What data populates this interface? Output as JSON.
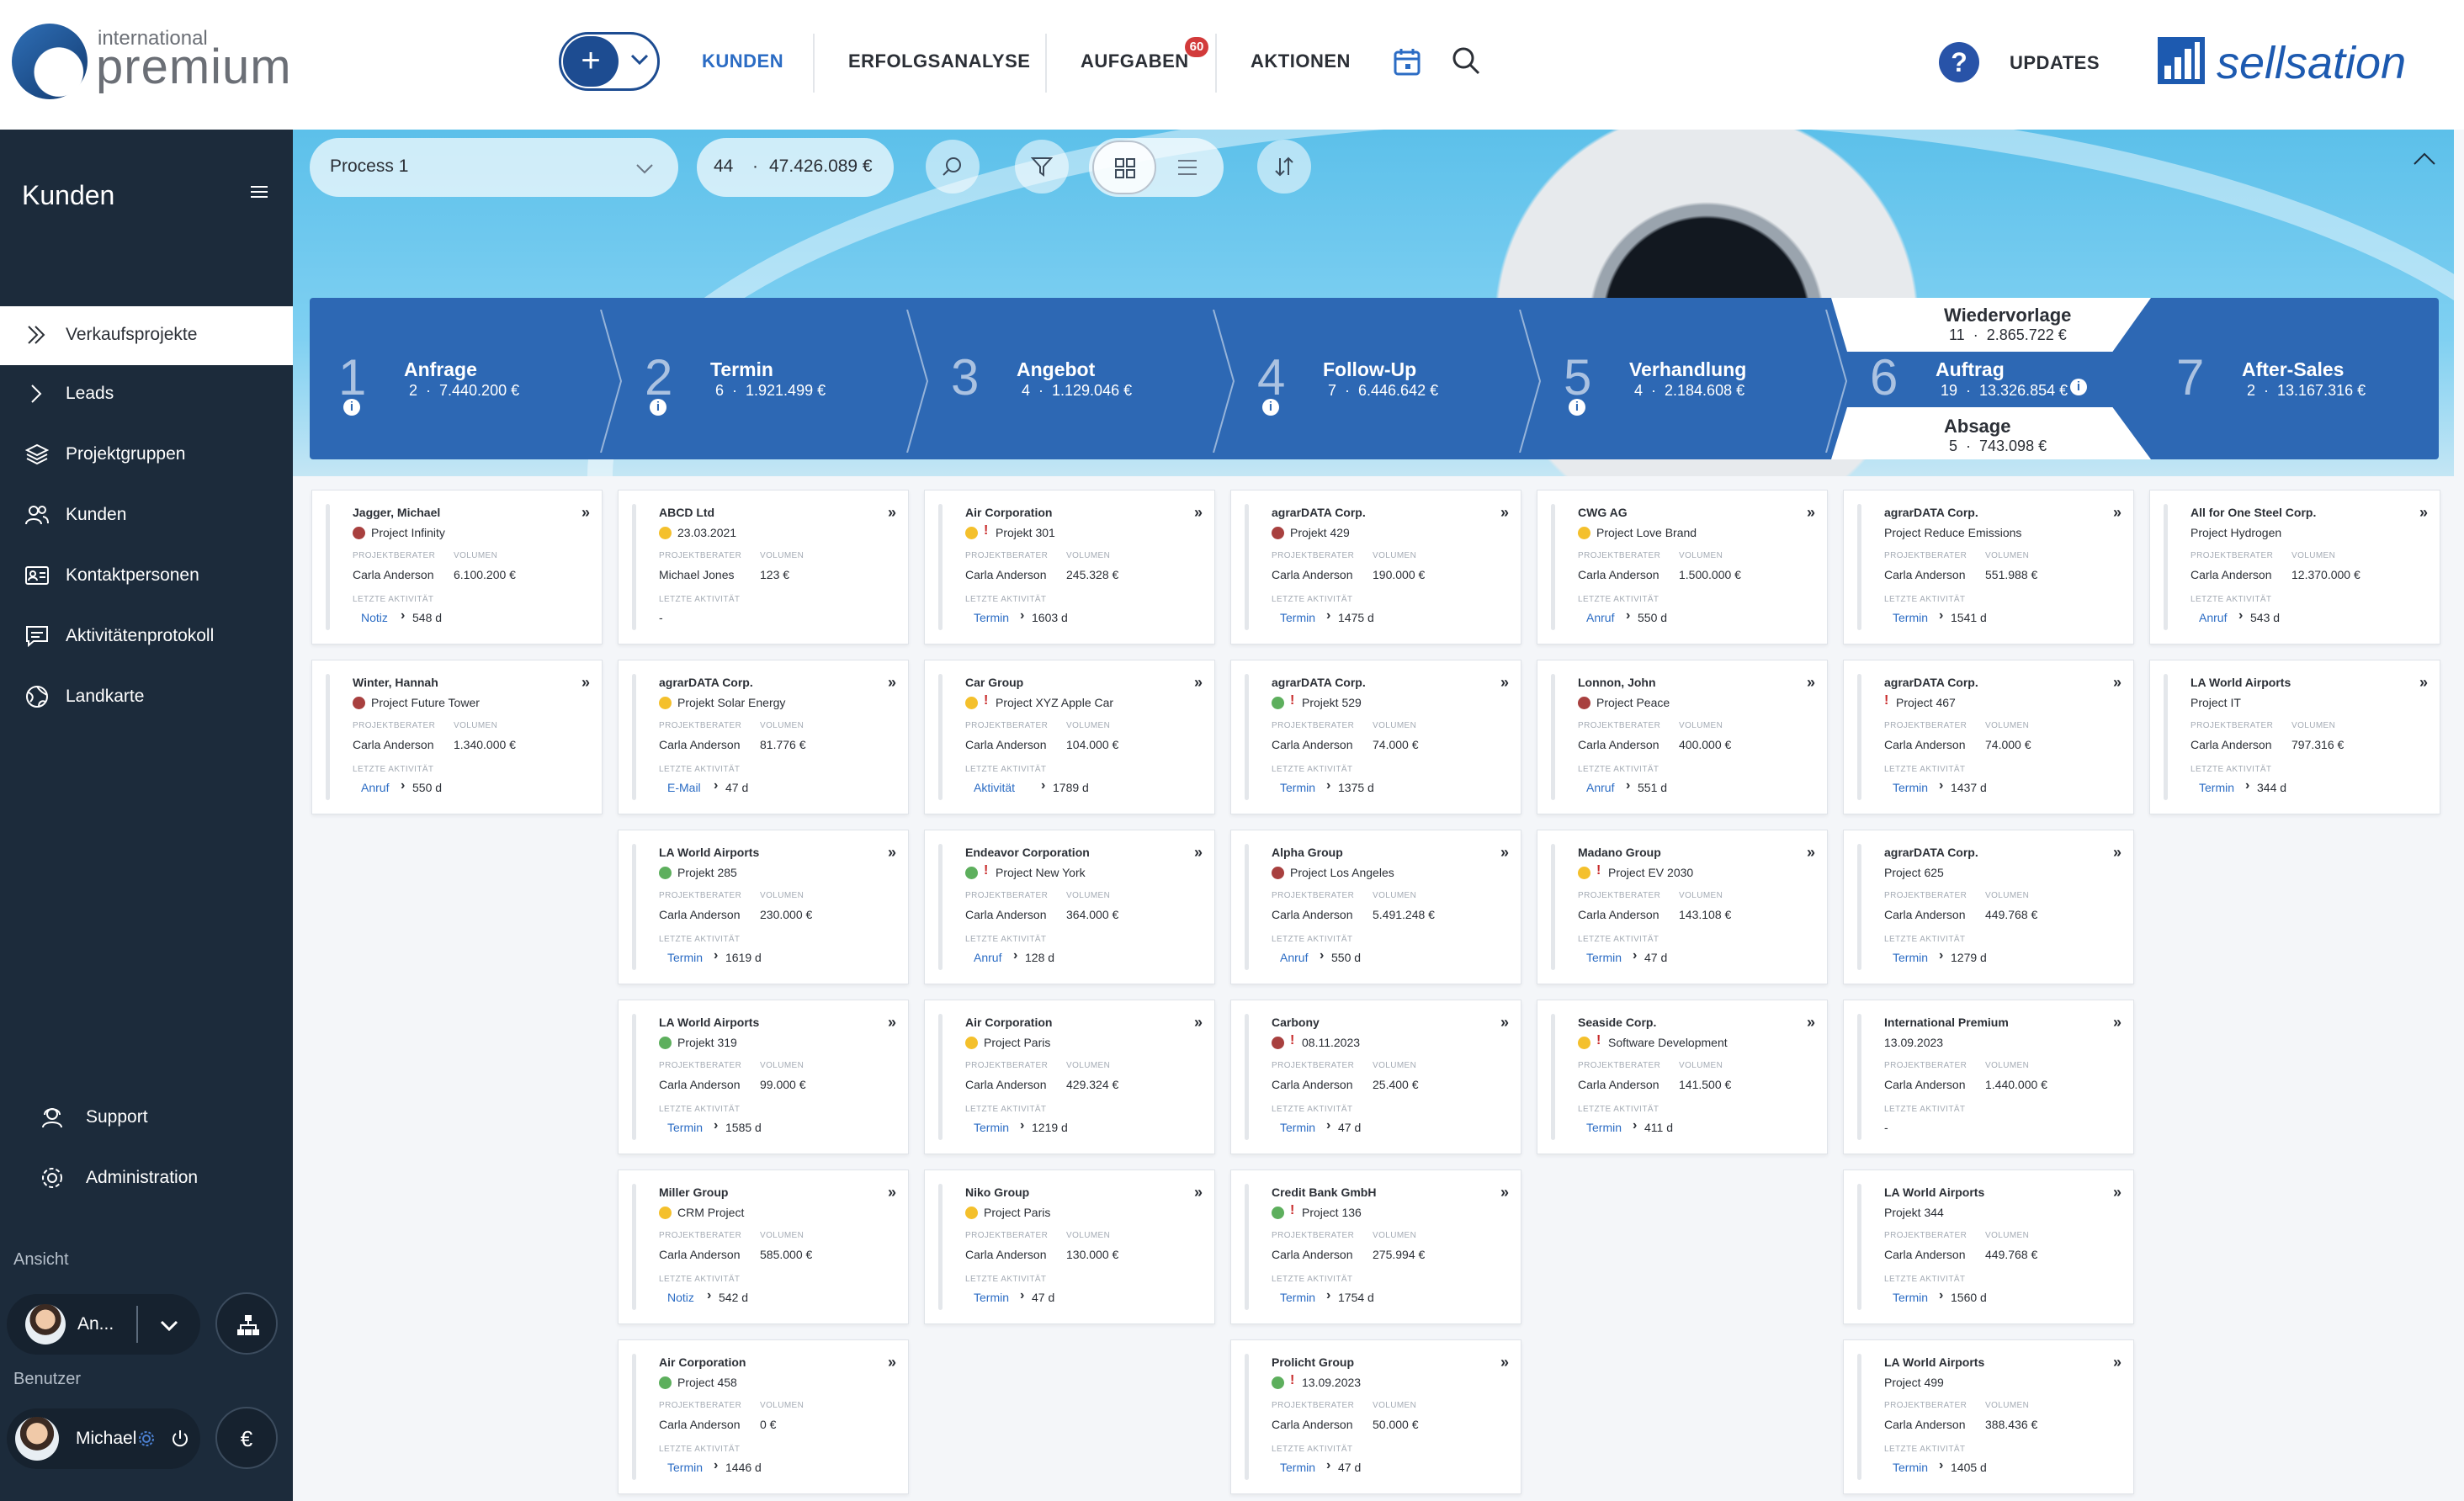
{
  "header": {
    "logo_small": "international",
    "logo_big": "premium",
    "nav": [
      "KUNDEN",
      "ERFOLGSANALYSE",
      "AUFGABEN",
      "AKTIONEN"
    ],
    "tasks_badge": "60",
    "updates_label": "UPDATES",
    "brand": "sellsation",
    "help": "?"
  },
  "sidebar": {
    "title": "Kunden",
    "items": [
      "Verkaufsprojekte",
      "Leads",
      "Projektgruppen",
      "Kunden",
      "Kontaktpersonen",
      "Aktivitätenprotokoll",
      "Landkarte"
    ],
    "bottom": [
      "Support",
      "Administration"
    ],
    "view_label": "Ansicht",
    "view_user": "An...",
    "user_label": "Benutzer",
    "user_name": "Michael",
    "currency": "€"
  },
  "toolbar": {
    "process": "Process 1",
    "count": "44",
    "sum": "47.426.089 €"
  },
  "stages": [
    {
      "num": "1",
      "name": "Anfrage",
      "count": "2",
      "sum": "7.440.200 €",
      "info": true
    },
    {
      "num": "2",
      "name": "Termin",
      "count": "6",
      "sum": "1.921.499 €",
      "info": true
    },
    {
      "num": "3",
      "name": "Angebot",
      "count": "4",
      "sum": "1.129.046 €",
      "info": false
    },
    {
      "num": "4",
      "name": "Follow-Up",
      "count": "7",
      "sum": "6.446.642 €",
      "info": true
    },
    {
      "num": "5",
      "name": "Verhandlung",
      "count": "4",
      "sum": "2.184.608 €",
      "info": true
    },
    {
      "num": "6",
      "name": "Auftrag",
      "count": "19",
      "sum": "13.326.854 €",
      "info": true
    },
    {
      "num": "7",
      "name": "After-Sales",
      "count": "2",
      "sum": "13.167.316 €",
      "info": false
    }
  ],
  "stage_split": {
    "top": {
      "name": "Wiedervorlage",
      "count": "11",
      "sum": "2.865.722 €"
    },
    "bottom": {
      "name": "Absage",
      "count": "5",
      "sum": "743.098 €"
    }
  },
  "card_labels": {
    "advisor": "PROJEKTBERATER",
    "volume": "VOLUMEN",
    "last": "LETZTE AKTIVITÄT"
  },
  "colors": {
    "red": "#a8403f",
    "yellow": "#f4c02c",
    "green": "#5daf5d",
    "accent": "#2b6cc4",
    "sidebar": "#1c2b3b",
    "stagebar": "#2d68b4"
  },
  "columns": [
    [
      {
        "company": "Jagger, Michael",
        "status": "red",
        "flag": false,
        "project": "Project Infinity",
        "advisor": "Carla Anderson",
        "volume": "6.100.200 €",
        "activity": "Notiz",
        "days": "548 d"
      },
      {
        "company": "Winter, Hannah",
        "status": "red",
        "flag": false,
        "project": "Project Future Tower",
        "advisor": "Carla Anderson",
        "volume": "1.340.000 €",
        "activity": "Anruf",
        "days": "550 d"
      }
    ],
    [
      {
        "company": "ABCD Ltd",
        "status": "yellow",
        "flag": false,
        "project": "23.03.2021",
        "advisor": "Michael Jones",
        "volume": "123 €",
        "activity": "",
        "days": ""
      },
      {
        "company": "agrarDATA Corp.",
        "status": "yellow",
        "flag": false,
        "project": "Projekt Solar Energy",
        "advisor": "Carla Anderson",
        "volume": "81.776 €",
        "activity": "E-Mail",
        "days": "47 d"
      },
      {
        "company": "LA World Airports",
        "status": "green",
        "flag": false,
        "project": "Projekt 285",
        "advisor": "Carla Anderson",
        "volume": "230.000 €",
        "activity": "Termin",
        "days": "1619 d"
      },
      {
        "company": "LA World Airports",
        "status": "green",
        "flag": false,
        "project": "Projekt 319",
        "advisor": "Carla Anderson",
        "volume": "99.000 €",
        "activity": "Termin",
        "days": "1585 d"
      },
      {
        "company": "Miller Group",
        "status": "yellow",
        "flag": false,
        "project": "CRM Project",
        "advisor": "Carla Anderson",
        "volume": "585.000 €",
        "activity": "Notiz",
        "days": "542 d"
      },
      {
        "company": "Air Corporation",
        "status": "green",
        "flag": false,
        "project": "Project 458",
        "advisor": "Carla Anderson",
        "volume": "0 €",
        "activity": "Termin",
        "days": "1446 d"
      }
    ],
    [
      {
        "company": "Air Corporation",
        "status": "yellow",
        "flag": true,
        "project": "Projekt 301",
        "advisor": "Carla Anderson",
        "volume": "245.328 €",
        "activity": "Termin",
        "days": "1603 d"
      },
      {
        "company": "Car Group",
        "status": "yellow",
        "flag": true,
        "project": "Project XYZ Apple Car",
        "advisor": "Carla Anderson",
        "volume": "104.000 €",
        "activity": "Aktivität",
        "days": "1789 d"
      },
      {
        "company": "Endeavor Corporation",
        "status": "green",
        "flag": true,
        "project": "Project New York",
        "advisor": "Carla Anderson",
        "volume": "364.000 €",
        "activity": "Anruf",
        "days": "128 d"
      },
      {
        "company": "Air Corporation",
        "status": "yellow",
        "flag": false,
        "project": "Project Paris",
        "advisor": "Carla Anderson",
        "volume": "429.324 €",
        "activity": "Termin",
        "days": "1219 d"
      },
      {
        "company": "Niko Group",
        "status": "yellow",
        "flag": false,
        "project": "Project Paris",
        "advisor": "Carla Anderson",
        "volume": "130.000 €",
        "activity": "Termin",
        "days": "47 d"
      }
    ],
    [
      {
        "company": "agrarDATA Corp.",
        "status": "red",
        "flag": false,
        "project": "Projekt 429",
        "advisor": "Carla Anderson",
        "volume": "190.000 €",
        "activity": "Termin",
        "days": "1475 d"
      },
      {
        "company": "agrarDATA Corp.",
        "status": "green",
        "flag": true,
        "project": "Projekt 529",
        "advisor": "Carla Anderson",
        "volume": "74.000 €",
        "activity": "Termin",
        "days": "1375 d"
      },
      {
        "company": "Alpha Group",
        "status": "red",
        "flag": false,
        "project": "Project Los Angeles",
        "advisor": "Carla Anderson",
        "volume": "5.491.248 €",
        "activity": "Anruf",
        "days": "550 d"
      },
      {
        "company": "Carbony",
        "status": "red",
        "flag": true,
        "project": "08.11.2023",
        "advisor": "Carla Anderson",
        "volume": "25.400 €",
        "activity": "Termin",
        "days": "47 d"
      },
      {
        "company": "Credit Bank GmbH",
        "status": "green",
        "flag": true,
        "project": "Project 136",
        "advisor": "Carla Anderson",
        "volume": "275.994 €",
        "activity": "Termin",
        "days": "1754 d"
      },
      {
        "company": "Prolicht Group",
        "status": "green",
        "flag": true,
        "project": "13.09.2023",
        "advisor": "Carla Anderson",
        "volume": "50.000 €",
        "activity": "Termin",
        "days": "47 d"
      }
    ],
    [
      {
        "company": "CWG AG",
        "status": "yellow",
        "flag": false,
        "project": "Project Love Brand",
        "advisor": "Carla Anderson",
        "volume": "1.500.000 €",
        "activity": "Anruf",
        "days": "550 d"
      },
      {
        "company": "Lonnon, John",
        "status": "red",
        "flag": false,
        "project": "Project Peace",
        "advisor": "Carla Anderson",
        "volume": "400.000 €",
        "activity": "Anruf",
        "days": "551 d"
      },
      {
        "company": "Madano Group",
        "status": "yellow",
        "flag": true,
        "project": "Project EV 2030",
        "advisor": "Carla Anderson",
        "volume": "143.108 €",
        "activity": "Termin",
        "days": "47 d"
      },
      {
        "company": "Seaside Corp.",
        "status": "yellow",
        "flag": true,
        "project": "Software Development",
        "advisor": "Carla Anderson",
        "volume": "141.500 €",
        "activity": "Termin",
        "days": "411 d"
      }
    ],
    [
      {
        "company": "agrarDATA Corp.",
        "status": "",
        "flag": false,
        "project": "Project Reduce Emissions",
        "advisor": "Carla Anderson",
        "volume": "551.988 €",
        "activity": "Termin",
        "days": "1541 d"
      },
      {
        "company": "agrarDATA Corp.",
        "status": "",
        "flag": true,
        "project": "Project 467",
        "advisor": "Carla Anderson",
        "volume": "74.000 €",
        "activity": "Termin",
        "days": "1437 d"
      },
      {
        "company": "agrarDATA Corp.",
        "status": "",
        "flag": false,
        "project": "Project 625",
        "advisor": "Carla Anderson",
        "volume": "449.768 €",
        "activity": "Termin",
        "days": "1279 d"
      },
      {
        "company": "International Premium",
        "status": "",
        "flag": false,
        "project": "13.09.2023",
        "advisor": "Carla Anderson",
        "volume": "1.440.000 €",
        "activity": "",
        "days": ""
      },
      {
        "company": "LA World Airports",
        "status": "",
        "flag": false,
        "project": "Projekt 344",
        "advisor": "Carla Anderson",
        "volume": "449.768 €",
        "activity": "Termin",
        "days": "1560 d"
      },
      {
        "company": "LA World Airports",
        "status": "",
        "flag": false,
        "project": "Project 499",
        "advisor": "Carla Anderson",
        "volume": "388.436 €",
        "activity": "Termin",
        "days": "1405 d"
      }
    ],
    [
      {
        "company": "All for One Steel Corp.",
        "status": "",
        "flag": false,
        "project": "Project Hydrogen",
        "advisor": "Carla Anderson",
        "volume": "12.370.000 €",
        "activity": "Anruf",
        "days": "543 d"
      },
      {
        "company": "LA World Airports",
        "status": "",
        "flag": false,
        "project": "Project IT",
        "advisor": "Carla Anderson",
        "volume": "797.316 €",
        "activity": "Termin",
        "days": "344 d"
      }
    ]
  ]
}
